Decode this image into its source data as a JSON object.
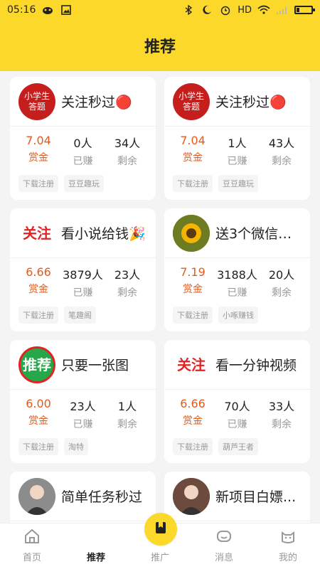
{
  "status_bar": {
    "time": "05:16",
    "network": "HD",
    "icons": [
      "cat-app-icon",
      "image-icon",
      "bluetooth-icon",
      "moon-icon",
      "alarm-icon",
      "wifi-icon",
      "signal-icon",
      "battery-icon"
    ],
    "battery_level": 0.2
  },
  "header": {
    "title": "推荐"
  },
  "cards": [
    {
      "thumb_text": [
        "小学生",
        "答题"
      ],
      "thumb_color": "#c61d1d",
      "title": "关注秒过🔴",
      "stats": {
        "reward": "7.04",
        "earned": "0人",
        "remaining": "34人"
      },
      "labels": {
        "reward": "赏金",
        "earned": "已赚",
        "remaining": "剩余"
      },
      "tags": [
        "下载注册",
        "豆豆趣玩"
      ]
    },
    {
      "thumb_text": [
        "小学生",
        "答题"
      ],
      "thumb_color": "#c61d1d",
      "title": "关注秒过🔴",
      "stats": {
        "reward": "7.04",
        "earned": "1人",
        "remaining": "43人"
      },
      "labels": {
        "reward": "赏金",
        "earned": "已赚",
        "remaining": "剩余"
      },
      "tags": [
        "下载注册",
        "豆豆趣玩"
      ]
    },
    {
      "thumb_text": [
        "关注"
      ],
      "thumb_color": "#ffffff",
      "thumb_text_color": "#e02424",
      "title": "看小说给钱🎉",
      "stats": {
        "reward": "6.66",
        "earned": "3879人",
        "remaining": "23人"
      },
      "labels": {
        "reward": "赏金",
        "earned": "已赚",
        "remaining": "剩余"
      },
      "tags": [
        "下载注册",
        "笔趣阁"
      ]
    },
    {
      "thumb_text": [
        ""
      ],
      "thumb_color": "#7f8f2d",
      "thumb_icon": "sunflower-photo",
      "title": "送3个微信红...",
      "stats": {
        "reward": "7.19",
        "earned": "3188人",
        "remaining": "20人"
      },
      "labels": {
        "reward": "赏金",
        "earned": "已赚",
        "remaining": "剩余"
      },
      "tags": [
        "下载注册",
        "小啄赚钱"
      ]
    },
    {
      "thumb_text": [
        "推荐"
      ],
      "thumb_color": "#e02424",
      "thumb_accent": "#26a84a",
      "title": "只要一张图",
      "stats": {
        "reward": "6.00",
        "earned": "23人",
        "remaining": "1人"
      },
      "labels": {
        "reward": "赏金",
        "earned": "已赚",
        "remaining": "剩余"
      },
      "tags": [
        "下载注册",
        "淘特"
      ]
    },
    {
      "thumb_text": [
        "关注"
      ],
      "thumb_color": "#ffffff",
      "thumb_text_color": "#e02424",
      "title": "看一分钟视频",
      "stats": {
        "reward": "6.66",
        "earned": "70人",
        "remaining": "33人"
      },
      "labels": {
        "reward": "赏金",
        "earned": "已赚",
        "remaining": "剩余"
      },
      "tags": [
        "下载注册",
        "葫芦王者"
      ]
    },
    {
      "thumb_text": [
        ""
      ],
      "thumb_color": "#8c8c8c",
      "thumb_icon": "person-photo",
      "title": "简单任务秒过",
      "stats": {
        "reward": "",
        "earned": "",
        "remaining": ""
      },
      "labels": {
        "reward": "",
        "earned": "",
        "remaining": ""
      },
      "tags": []
    },
    {
      "thumb_text": [
        ""
      ],
      "thumb_color": "#6c4b3e",
      "thumb_icon": "person-photo",
      "title": "新项目白嫖...",
      "stats": {
        "reward": "",
        "earned": "",
        "remaining": ""
      },
      "labels": {
        "reward": "",
        "earned": "",
        "remaining": ""
      },
      "tags": []
    }
  ],
  "bottom_nav": {
    "items": [
      {
        "label": "首页",
        "icon": "home-icon"
      },
      {
        "label": "推荐",
        "icon": "bookmark-icon",
        "active": true
      },
      {
        "label": "推广",
        "icon": "compass-icon"
      },
      {
        "label": "消息",
        "icon": "message-icon"
      },
      {
        "label": "我的",
        "icon": "cat-face-icon"
      }
    ]
  },
  "colors": {
    "brand_yellow": "#fcd82a",
    "reward_orange": "#e15b1c",
    "muted_text": "#999999"
  }
}
